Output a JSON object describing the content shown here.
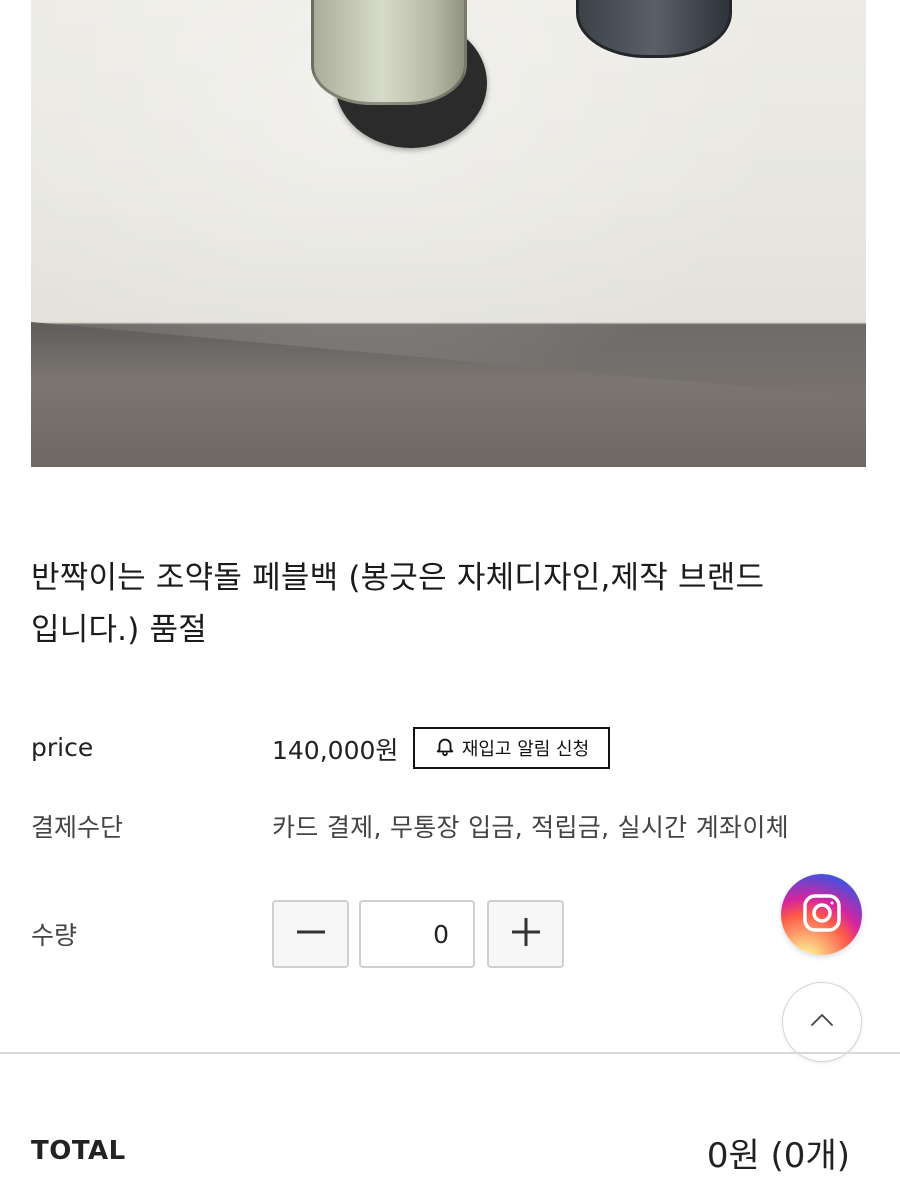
{
  "product": {
    "title_line1": "반짝이는 조약돌 페블백 (봉긋은 자체디자인,제작 브랜드",
    "title_line2": "입니다.) 품절"
  },
  "price": {
    "label": "price",
    "value": "140,000원",
    "restock_button": "재입고 알림 신청"
  },
  "payment": {
    "label": "결제수단",
    "value": "카드 결제, 무통장 입금, 적립금, 실시간 계좌이체"
  },
  "quantity": {
    "label": "수량",
    "value": "0"
  },
  "total": {
    "label": "TOTAL",
    "value": "0원 (0개)"
  },
  "icons": {
    "bell": "bell-icon",
    "minus": "minus-icon",
    "plus": "plus-icon",
    "instagram": "instagram-icon",
    "scroll_top": "chevron-up-icon"
  }
}
